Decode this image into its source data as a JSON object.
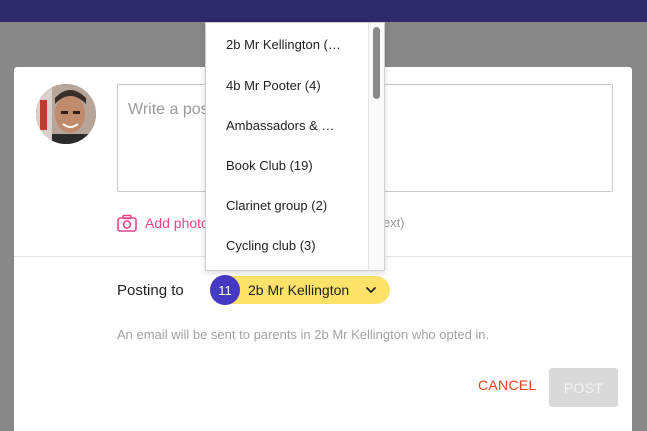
{
  "composer": {
    "placeholder": "Write a post",
    "placeholder_visible": "Write a pos",
    "add_photo_label": "Add photo",
    "alt_text_fragment": "t text)"
  },
  "posting": {
    "label": "Posting to",
    "count": "11",
    "selected_group": "2b Mr Kellington",
    "email_note": "An email will be sent to parents in 2b Mr Kellington who opted in."
  },
  "actions": {
    "cancel_label": "CANCEL",
    "post_label": "POST"
  },
  "dropdown": {
    "items": [
      "2b Mr Kellington (…",
      "4b Mr Pooter (4)",
      "Ambassadors & …",
      "Book Club (19)",
      "Clarinet group (2)",
      "Cycling club (3)"
    ]
  },
  "colors": {
    "topbar": "#2f2a6b",
    "accent_pink": "#e8458c",
    "pill_yellow": "#fde26a",
    "count_badge": "#4339c3",
    "cancel": "#e2451c"
  }
}
